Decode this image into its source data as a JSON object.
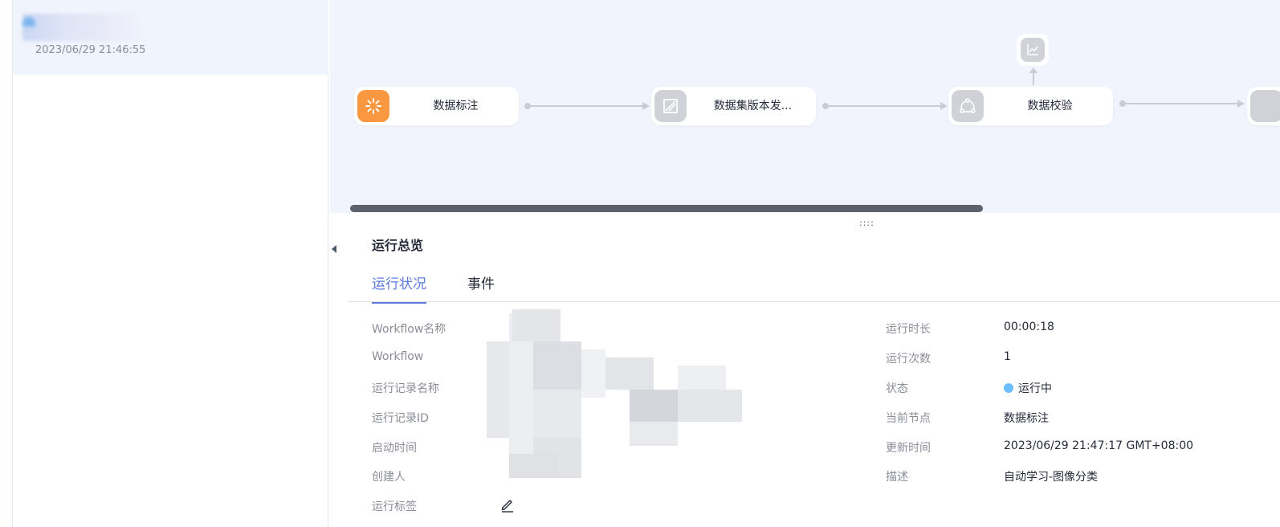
{
  "run_list": {
    "items": [
      {
        "time": "2023/06/29 21:46:55"
      }
    ]
  },
  "workflow": {
    "nodes": [
      {
        "label": "数据标注",
        "icon": "loading-spinner-icon",
        "state": "running"
      },
      {
        "label": "数据集版本发...",
        "icon": "dataset-version-icon",
        "state": "pending"
      },
      {
        "label": "数据校验",
        "icon": "data-check-icon",
        "state": "pending"
      }
    ],
    "branch_node_icon": "line-chart-icon"
  },
  "overview": {
    "title": "运行总览",
    "tabs": [
      {
        "label": "运行状况",
        "active": true
      },
      {
        "label": "事件",
        "active": false
      }
    ],
    "left_fields": [
      {
        "label": "Workflow名称"
      },
      {
        "label": "Workflow"
      },
      {
        "label": "运行记录名称"
      },
      {
        "label": "运行记录ID"
      },
      {
        "label": "启动时间"
      },
      {
        "label": "创建人"
      },
      {
        "label": "运行标签"
      }
    ],
    "right_fields": [
      {
        "label": "运行时长",
        "value": "00:00:18"
      },
      {
        "label": "运行次数",
        "value": "1"
      },
      {
        "label": "状态",
        "value": "运行中"
      },
      {
        "label": "当前节点",
        "value": "数据标注"
      },
      {
        "label": "更新时间",
        "value": "2023/06/29 21:47:17 GMT+08:00"
      },
      {
        "label": "描述",
        "value": "自动学习-图像分类"
      }
    ],
    "status_color": "#6cbfff",
    "accent_color": "#5e7ce0",
    "running_node_color": "#fa9841"
  }
}
